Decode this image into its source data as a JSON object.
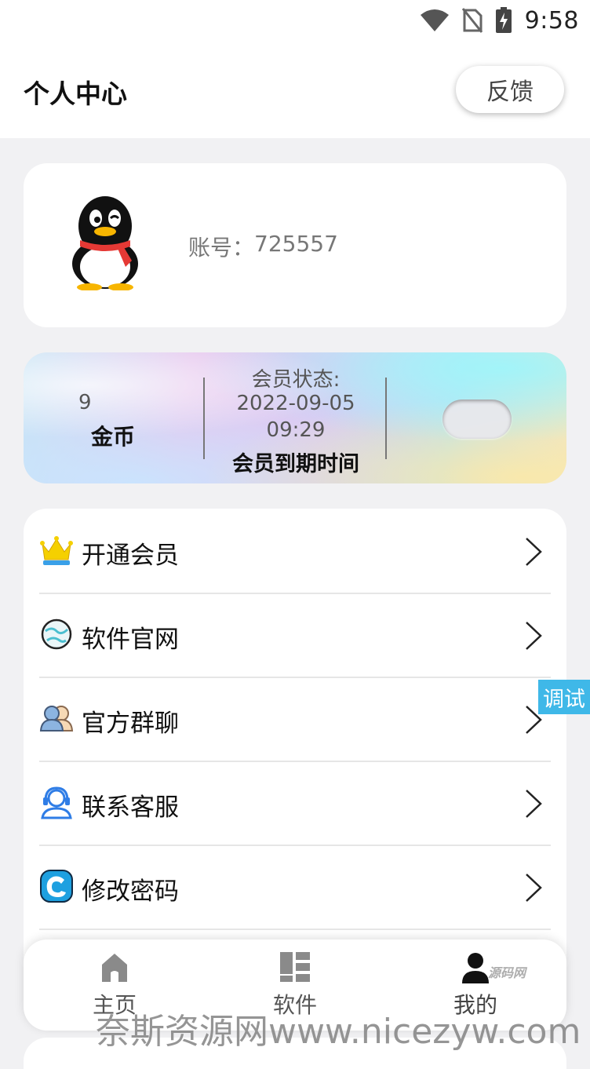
{
  "status_bar": {
    "time": "9:58",
    "icons": [
      "wifi-icon",
      "no-sim-icon",
      "battery-charging-icon"
    ]
  },
  "header": {
    "title": "个人中心",
    "feedback_label": "反馈"
  },
  "profile": {
    "avatar_icon": "qq-penguin-avatar",
    "account_label": "账号：",
    "account_value": "725557"
  },
  "stats": {
    "coins_value": "9",
    "coins_label": "金币",
    "member_status_label": "会员状态:",
    "member_expiry_value": "2022-09-05 09:29",
    "member_expiry_label": "会员到期时间"
  },
  "menu": [
    {
      "label": "开通会员",
      "icon": "crown-icon"
    },
    {
      "label": "软件官网",
      "icon": "globe-icon"
    },
    {
      "label": "官方群聊",
      "icon": "group-chat-icon"
    },
    {
      "label": "联系客服",
      "icon": "customer-service-icon"
    },
    {
      "label": "修改密码",
      "icon": "edit-password-icon"
    }
  ],
  "debug_tab": "调试",
  "bottom_nav": [
    {
      "label": "主页",
      "icon": "home-icon"
    },
    {
      "label": "软件",
      "icon": "apps-grid-icon"
    },
    {
      "label": "我的",
      "icon": "person-icon",
      "active": true
    }
  ],
  "watermark": {
    "text": "奈斯资源网www.nicezyw.com",
    "nav_overlay": "源码网"
  },
  "colors": {
    "page_bg": "#f1f1f3",
    "debug_tab": "#3fb8e8",
    "crown": "#f5d000",
    "service_blue": "#2f7de6"
  }
}
